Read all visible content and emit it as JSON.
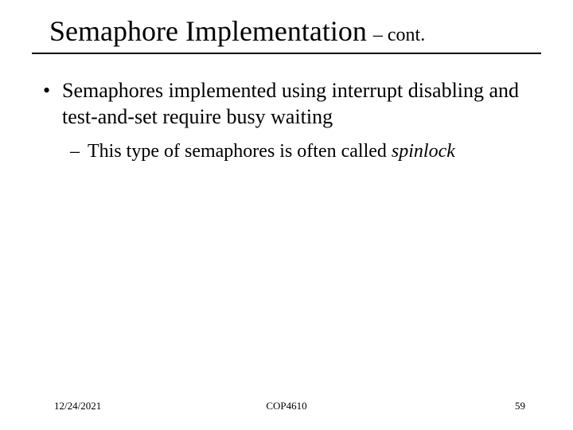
{
  "title": {
    "main": "Semaphore Implementation",
    "suffix": " – cont."
  },
  "bullet": {
    "marker": "•",
    "text": "Semaphores implemented using interrupt disabling and test-and-set require busy waiting"
  },
  "subbullet": {
    "marker": "–",
    "prefix": "This type of semaphores is often called ",
    "italic": "spinlock"
  },
  "footer": {
    "date": "12/24/2021",
    "course": "COP4610",
    "page": "59"
  }
}
